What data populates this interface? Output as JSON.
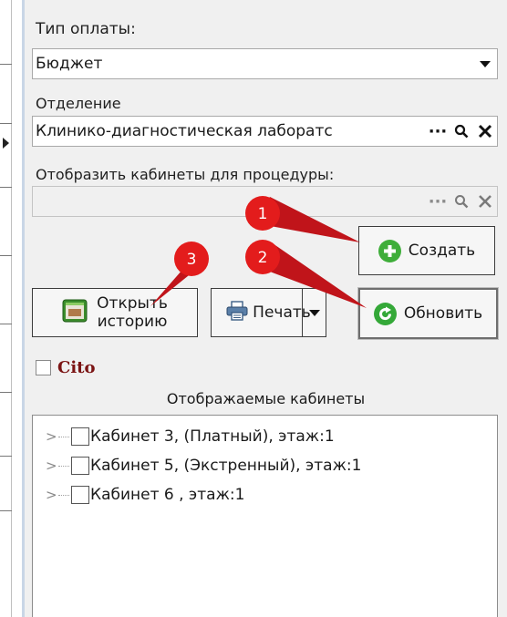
{
  "payment": {
    "label": "Тип оплаты:",
    "value": "Бюджет"
  },
  "department": {
    "label": "Отделение",
    "value": "Клинико-диагностическая лаборатс",
    "ellipsis": "···"
  },
  "procedure_rooms": {
    "label": "Отобразить кабинеты для процедуры:",
    "value": "",
    "ellipsis": "···"
  },
  "buttons": {
    "create": "Создать",
    "open_history_line1": "Открыть",
    "open_history_line2": "историю",
    "print": "Печать",
    "refresh": "Обновить"
  },
  "cito": {
    "label": "Cito",
    "checked": false
  },
  "rooms": {
    "title": "Отображаемые кабинеты",
    "items": [
      {
        "label": "Кабинет 3, (Платный), этаж:1",
        "checked": false
      },
      {
        "label": "Кабинет 5, (Экстренный), этаж:1",
        "checked": false
      },
      {
        "label": "Кабинет 6 , этаж:1",
        "checked": false
      }
    ]
  },
  "annotations": [
    {
      "number": "1",
      "target": "create-button"
    },
    {
      "number": "2",
      "target": "refresh-button"
    },
    {
      "number": "3",
      "target": "open-history-button"
    }
  ],
  "colors": {
    "annotation_red": "#e31c1c",
    "cito_text": "#7b1414",
    "icon_green": "#3fae3a",
    "panel_bg": "#f0f0f0"
  }
}
